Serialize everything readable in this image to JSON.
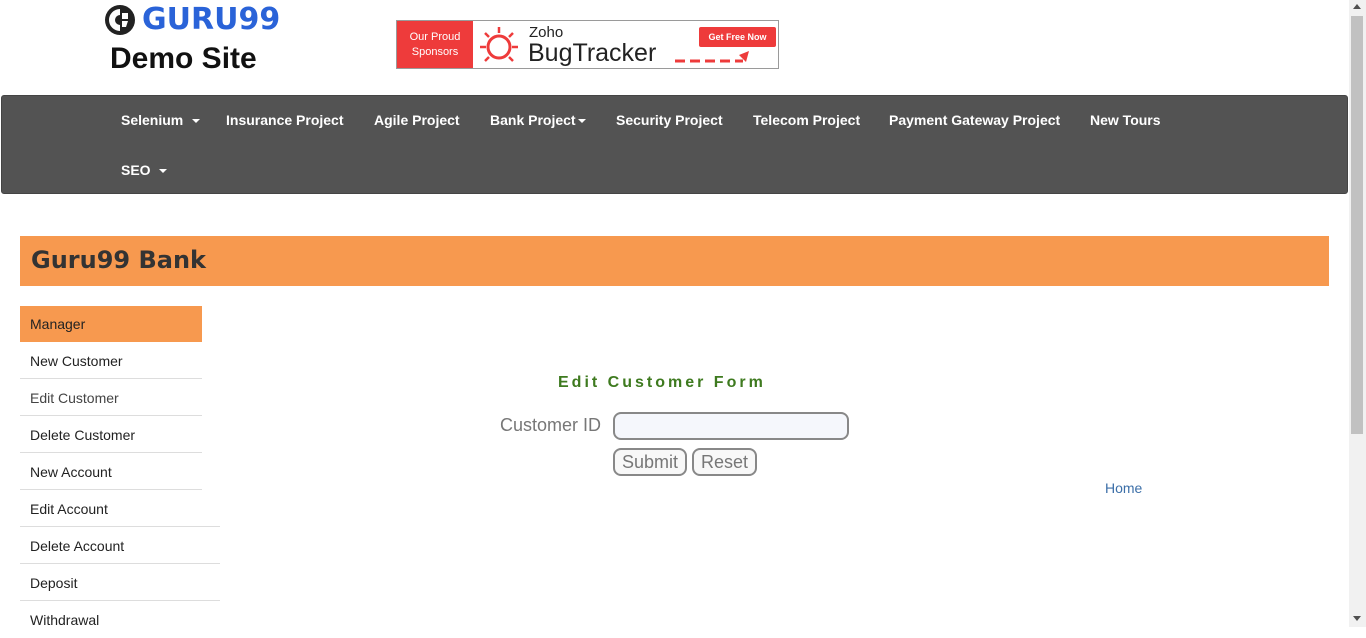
{
  "brand": {
    "logo_text": "GURU99",
    "subtitle": "Demo Site",
    "logo_color": "#2a63d8"
  },
  "banner": {
    "left_line1": "Our Proud",
    "left_line2": "Sponsors",
    "zoho": "Zoho",
    "product": "BugTracker",
    "cta": "Get Free Now",
    "accent": "#ee3b3b"
  },
  "nav": {
    "items": [
      {
        "label": "Selenium",
        "dropdown": true
      },
      {
        "label": "Insurance Project",
        "dropdown": false
      },
      {
        "label": "Agile Project",
        "dropdown": false
      },
      {
        "label": "Bank Project",
        "dropdown": true
      },
      {
        "label": "Security Project",
        "dropdown": false
      },
      {
        "label": "Telecom Project",
        "dropdown": false
      },
      {
        "label": "Payment Gateway Project",
        "dropdown": false
      },
      {
        "label": "New Tours",
        "dropdown": false
      },
      {
        "label": "SEO",
        "dropdown": true
      }
    ],
    "bg": "#535353"
  },
  "bank": {
    "title": "Guru99 Bank",
    "accent": "#f7994f"
  },
  "sidebar": {
    "items": [
      {
        "label": "Manager"
      },
      {
        "label": "New Customer"
      },
      {
        "label": "Edit Customer"
      },
      {
        "label": "Delete Customer"
      },
      {
        "label": "New Account"
      },
      {
        "label": "Edit Account"
      },
      {
        "label": "Delete Account"
      },
      {
        "label": "Deposit"
      },
      {
        "label": "Withdrawal"
      }
    ]
  },
  "form": {
    "title": "Edit Customer Form",
    "customer_id_label": "Customer ID",
    "customer_id_value": "",
    "submit_label": "Submit",
    "reset_label": "Reset",
    "title_color": "#3e7a1f"
  },
  "home_link": "Home"
}
